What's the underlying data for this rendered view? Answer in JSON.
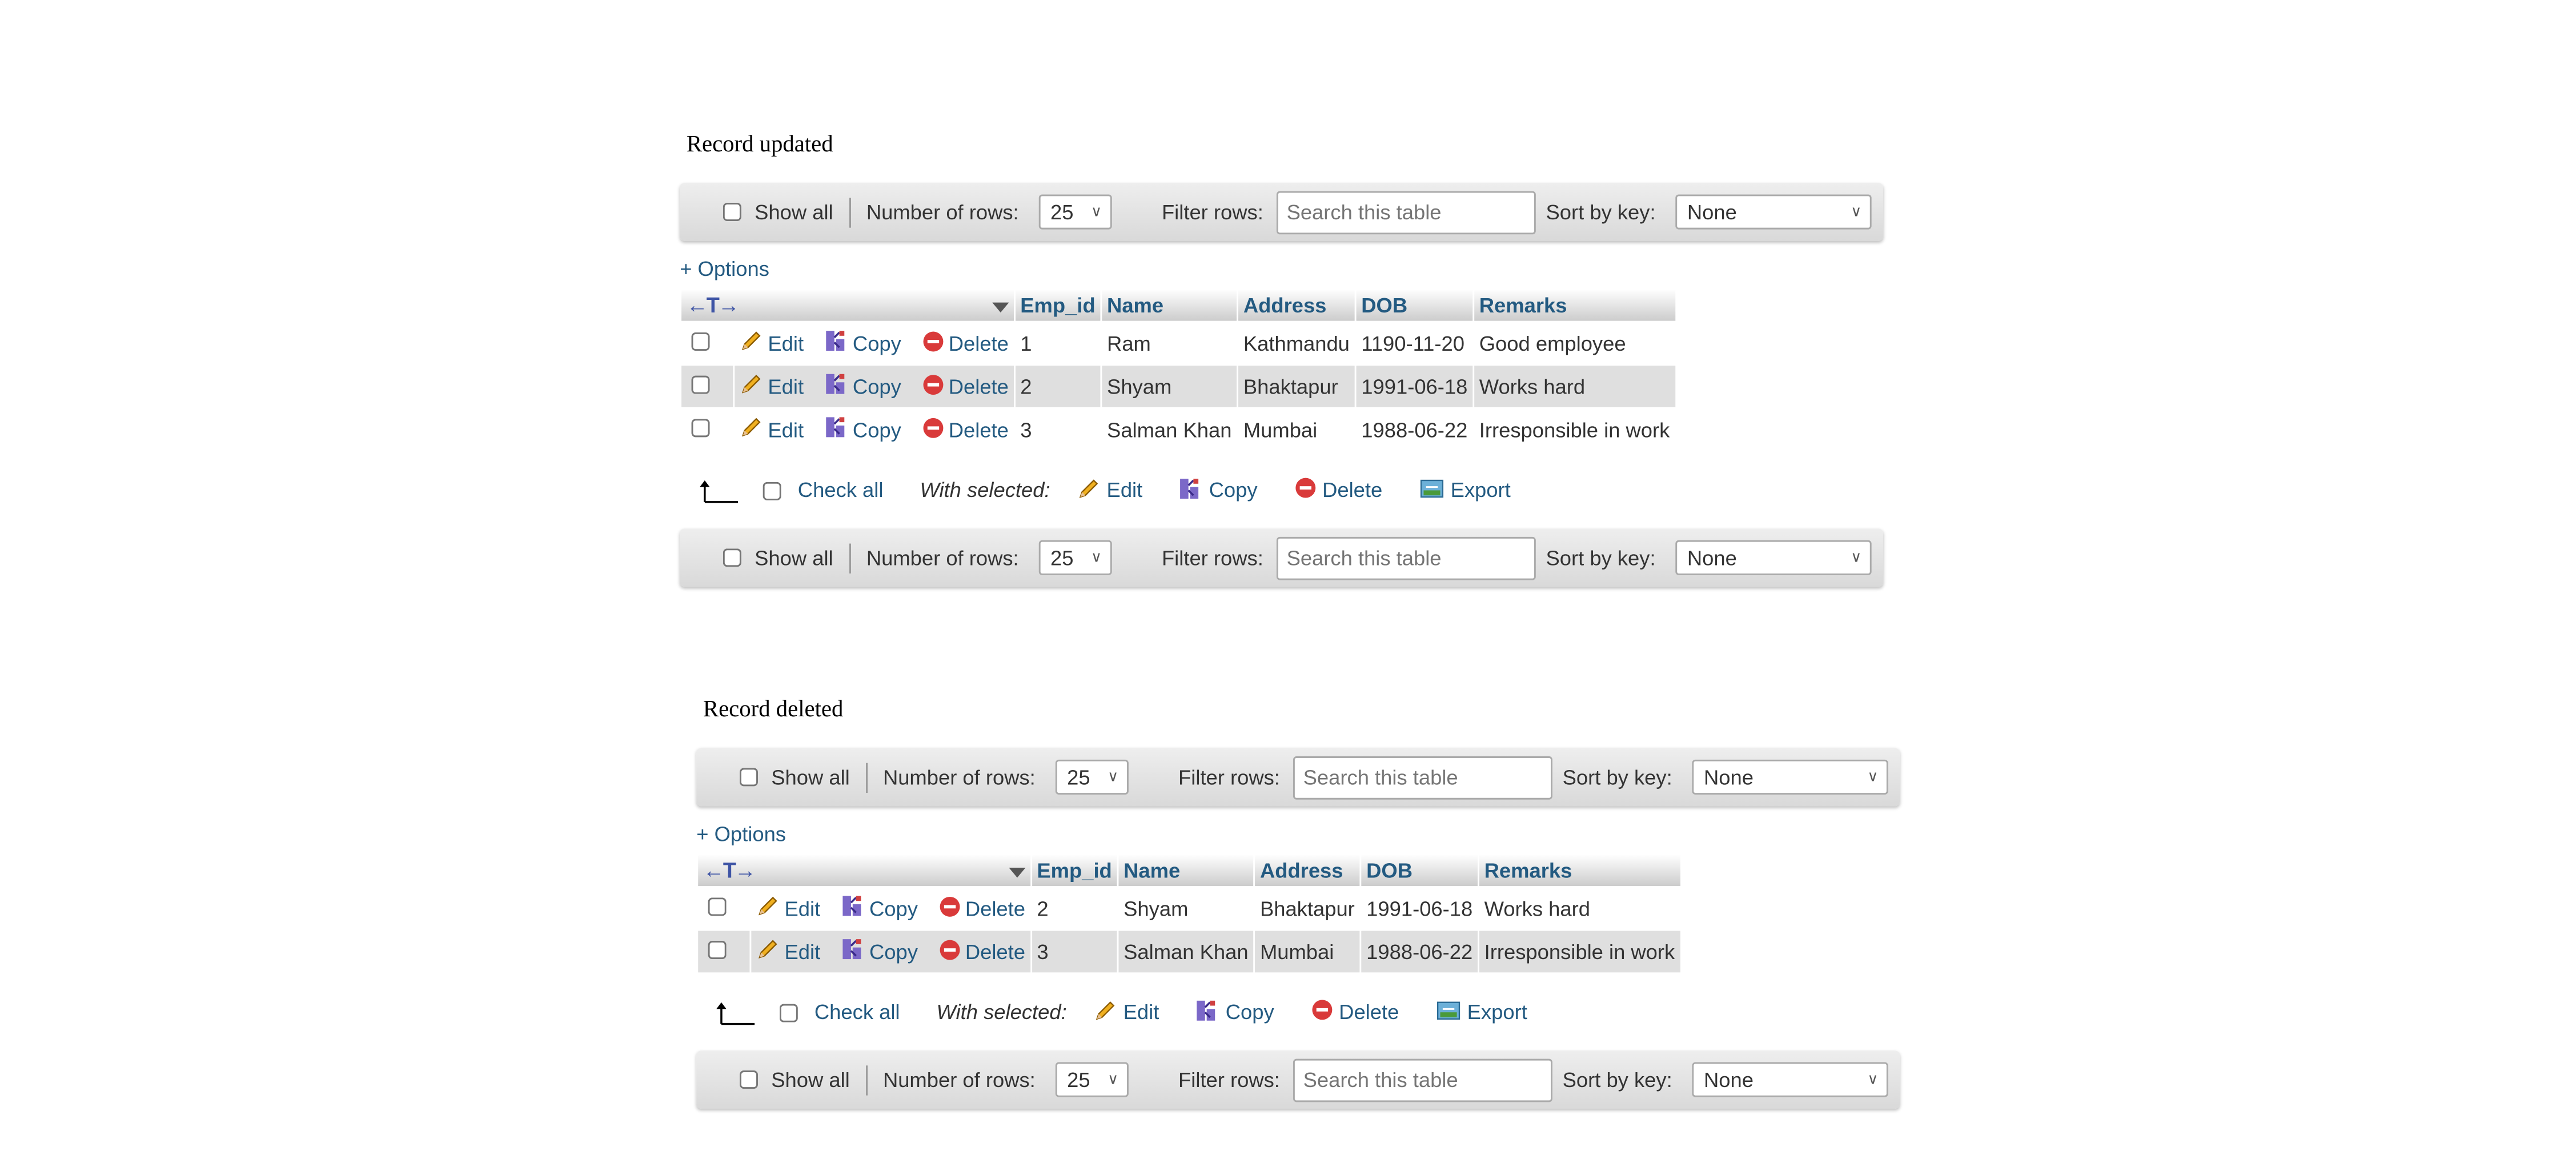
{
  "controls": {
    "show_all": "Show all",
    "rows_label": "Number of rows:",
    "rows_value": "25",
    "filter_label": "Filter rows:",
    "filter_placeholder": "Search this table",
    "sort_label": "Sort by key:",
    "sort_value": "None",
    "options": "+ Options",
    "check_all": "Check all",
    "with_selected": "With selected:",
    "edit": "Edit",
    "copy": "Copy",
    "delete": "Delete",
    "export": "Export"
  },
  "columns": [
    "Emp_id",
    "Name",
    "Address",
    "DOB",
    "Remarks"
  ],
  "icons": [
    "pencil-icon",
    "copy-icon",
    "delete-icon",
    "export-icon",
    "column-arrows-icon",
    "sort-triangle-icon",
    "arrow-up-corner-icon"
  ],
  "colors": {
    "link": "#235a81",
    "row_alt": "#dfdfdf"
  },
  "sections": [
    {
      "heading": "Record updated",
      "rows": [
        [
          "1",
          "Ram",
          "Kathmandu",
          "1190-11-20",
          "Good employee"
        ],
        [
          "2",
          "Shyam",
          "Bhaktapur",
          "1991-06-18",
          "Works hard"
        ],
        [
          "3",
          "Salman Khan",
          "Mumbai",
          "1988-06-22",
          "Irresponsible in work"
        ]
      ]
    },
    {
      "heading": "Record deleted",
      "rows": [
        [
          "2",
          "Shyam",
          "Bhaktapur",
          "1991-06-18",
          "Works hard"
        ],
        [
          "3",
          "Salman Khan",
          "Mumbai",
          "1988-06-22",
          "Irresponsible in work"
        ]
      ]
    }
  ]
}
